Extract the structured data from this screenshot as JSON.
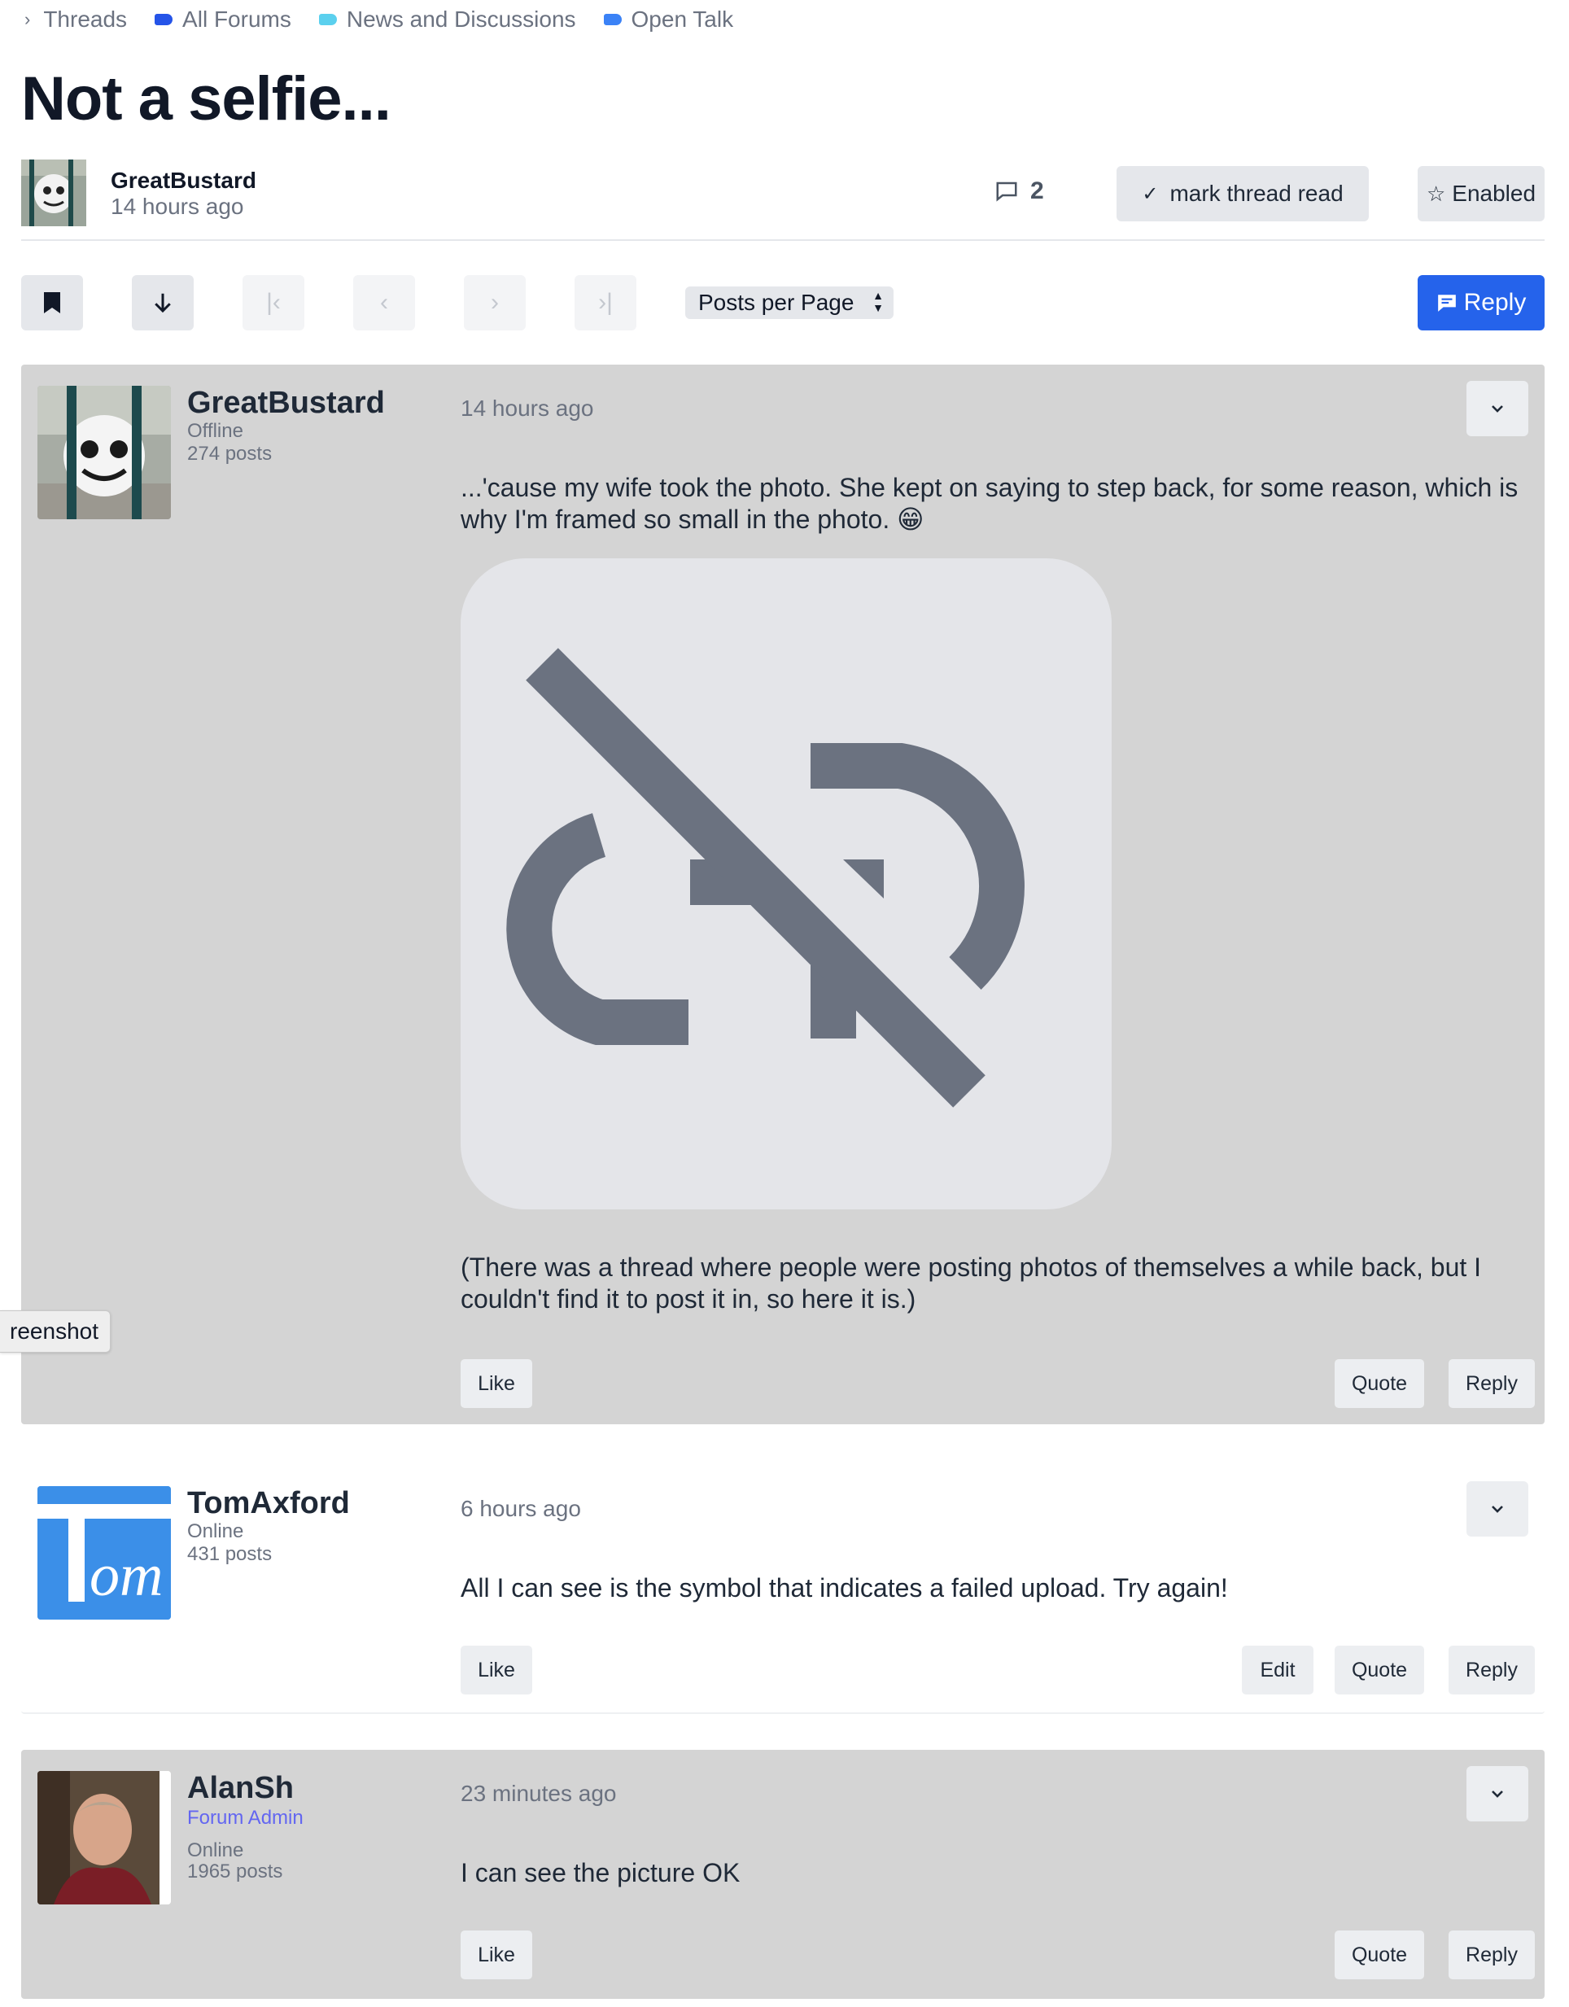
{
  "breadcrumb": [
    {
      "label": "Threads",
      "icon": "chevron-right-icon"
    },
    {
      "label": "All Forums",
      "color": "#2554e8"
    },
    {
      "label": "News and Discussions",
      "color": "#5bd0ee"
    },
    {
      "label": "Open Talk",
      "color": "#3b82f6"
    }
  ],
  "thread": {
    "title": "Not a selfie...",
    "author": "GreatBustard",
    "time": "14 hours ago",
    "comment_count": "2",
    "mark_read_label": "mark thread read",
    "watch_label": "Enabled"
  },
  "toolbar": {
    "posts_per_page": "Posts per Page",
    "reply_label": "Reply"
  },
  "posts": [
    {
      "author": "GreatBustard",
      "status": "Offline",
      "post_count": "274 posts",
      "time": "14 hours ago",
      "text1": "...'cause my wife took the photo. She kept on saying to step back, for some reason, which is why I'm framed so small in the photo. 😁",
      "text2": "(There was a thread where people were posting photos of themselves a while back, but I couldn't find it to post it in, so here it is.)",
      "like": "Like",
      "quote": "Quote",
      "reply": "Reply"
    },
    {
      "author": "TomAxford",
      "avatar_text": "Tom",
      "status": "Online",
      "post_count": "431 posts",
      "time": "6 hours ago",
      "text1": "All I can see is the symbol that indicates a failed upload. Try again!",
      "like": "Like",
      "edit": "Edit",
      "quote": "Quote",
      "reply": "Reply"
    },
    {
      "author": "AlanSh",
      "role": "Forum Admin",
      "status": "Online",
      "post_count": "1965 posts",
      "time": "23 minutes ago",
      "text1": "I can see the picture OK",
      "like": "Like",
      "quote": "Quote",
      "reply": "Reply"
    }
  ],
  "tooltip": "reenshot",
  "colors": {
    "accent": "#2563eb",
    "post_shaded": "#d4d4d4",
    "broken_image_icon": "#6b7280",
    "admin_role": "#6366f1"
  }
}
